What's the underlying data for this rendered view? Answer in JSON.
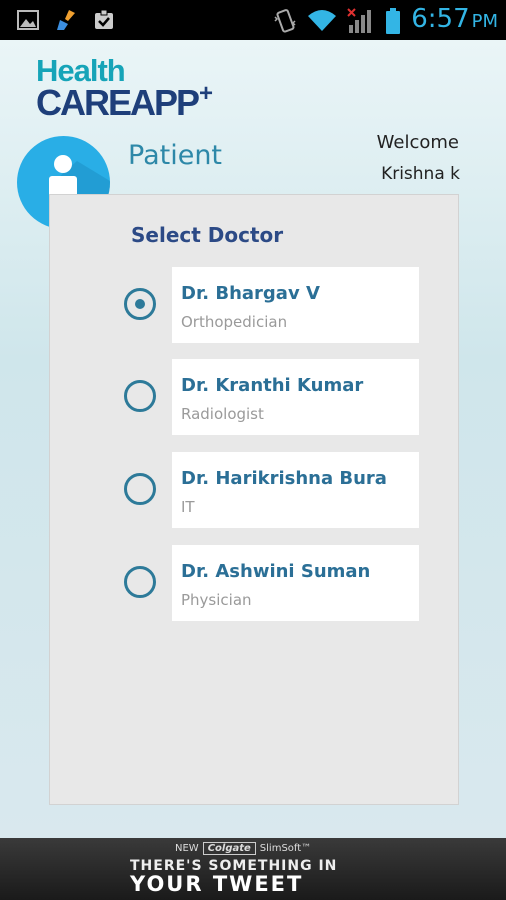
{
  "status_bar": {
    "time": "6:57",
    "ampm": "PM",
    "icons": [
      "image-icon",
      "cleaner-icon",
      "clipboard-icon",
      "vibrate-icon",
      "wifi-icon",
      "signal-icon",
      "battery-icon"
    ]
  },
  "header": {
    "logo_health": "Health",
    "logo_care": "CAREAPP",
    "logo_plus": "+",
    "welcome_label": "Welcome",
    "user_name": "Krishna k"
  },
  "page": {
    "title": "Patient",
    "section_title": "Select Doctor"
  },
  "doctors": [
    {
      "name": "Dr. Bhargav V",
      "specialty": "Orthopedician",
      "selected": true
    },
    {
      "name": "Dr. Kranthi Kumar",
      "specialty": "Radiologist",
      "selected": false
    },
    {
      "name": "Dr. Harikrishna Bura",
      "specialty": "IT",
      "selected": false
    },
    {
      "name": "Dr. Ashwini Suman",
      "specialty": "Physician",
      "selected": false
    }
  ],
  "ad": {
    "new_label": "NEW",
    "brand": "Colgate",
    "product": "SlimSoft™",
    "line1": "THERE'S SOMETHING IN",
    "line2": "YOUR TWEET"
  },
  "colors": {
    "accent": "#33b5e5",
    "avatar": "#29aee6",
    "radio": "#2d7a99",
    "doctor_name": "#2b6f96",
    "section_title": "#2c4a86"
  }
}
